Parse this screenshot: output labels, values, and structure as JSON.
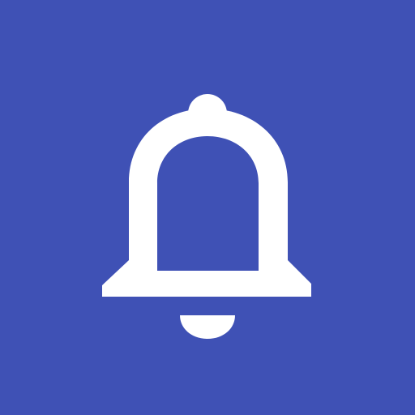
{
  "icon": {
    "name": "bell-icon",
    "background_color": "#3F51B5",
    "foreground_color": "#FFFFFF"
  }
}
